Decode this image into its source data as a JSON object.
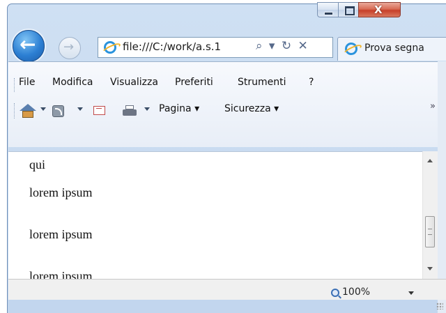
{
  "window": {
    "controls": {
      "minimize": "minimize",
      "maximize": "maximize",
      "close_glyph": "X"
    }
  },
  "nav": {
    "back_icon": "back-arrow-icon",
    "forward_icon": "forward-arrow-icon",
    "address": "file:///C:/work/a.s.1",
    "address_tools": "⌕ ▾ ↻ ✕",
    "tab_title": "Prova segna"
  },
  "menu": [
    {
      "label": "File"
    },
    {
      "label": "Modifica"
    },
    {
      "label": "Visualizza"
    },
    {
      "label": "Preferiti"
    },
    {
      "label": "Strumenti"
    },
    {
      "label": "?"
    }
  ],
  "commandbar": {
    "page_label": "Pagina ▾",
    "security_label": "Sicurezza ▾",
    "overflow": "»",
    "icons": [
      "home-icon",
      "rss-icon",
      "mail-icon",
      "print-icon"
    ]
  },
  "content": {
    "lines": [
      "qui",
      "lorem ipsum",
      "lorem ipsum",
      "lorem ipsum"
    ]
  },
  "status": {
    "zoom": "100%"
  }
}
